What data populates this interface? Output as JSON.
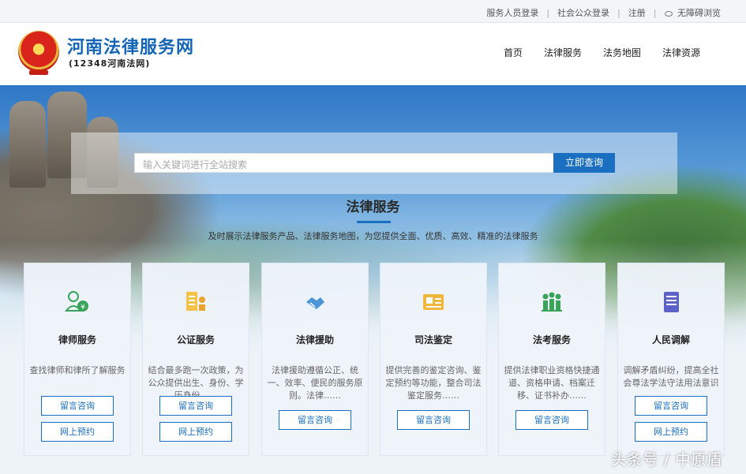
{
  "topbar": {
    "links": [
      "服务人员登录",
      "社会公众登录",
      "注册"
    ],
    "accessibility_label": "无障碍浏览"
  },
  "header": {
    "title": "河南法律服务网",
    "subtitle": "(12348河南法网)",
    "nav": [
      "首页",
      "法律服务",
      "法务地图",
      "法律资源"
    ]
  },
  "search": {
    "placeholder": "输入关键词进行全站搜索",
    "button": "立即查询"
  },
  "section": {
    "title": "法律服务",
    "description": "及时展示法律服务产品、法律服务地图，为您提供全面、优质、高效、精准的法律服务"
  },
  "cards": [
    {
      "name": "律师服务",
      "icon": "lawyer-icon",
      "desc": "查找律师和律所了解服务",
      "buttons": [
        "留言咨询",
        "网上预约"
      ]
    },
    {
      "name": "公证服务",
      "icon": "notary-icon",
      "desc": "结合最多跑一次政策，为公众提供出生、身份、学历身份……",
      "buttons": [
        "留言咨询",
        "网上预约"
      ]
    },
    {
      "name": "法律援助",
      "icon": "handshake-icon",
      "desc": "法律援助遵循公正、统一、效率、便民的服务原则。法律……",
      "buttons": [
        "留言咨询"
      ]
    },
    {
      "name": "司法鉴定",
      "icon": "appraisal-icon",
      "desc": "提供完善的鉴定咨询、鉴定预约等功能，整合司法鉴定服务……",
      "buttons": [
        "留言咨询"
      ]
    },
    {
      "name": "法考服务",
      "icon": "exam-icon",
      "desc": "提供法律职业资格快捷通道、资格申请、档案迁移、证书补办……",
      "buttons": [
        "留言咨询"
      ]
    },
    {
      "name": "人民调解",
      "icon": "mediation-book-icon",
      "desc": "调解矛盾纠纷，提高全社会尊法学法守法用法意识",
      "buttons": [
        "留言咨询",
        "网上预约"
      ]
    }
  ],
  "watermark": "头条号 / 中原盾",
  "colors": {
    "brand_blue": "#1a6fc0",
    "title_blue": "#1565b7",
    "emblem_red": "#d8241b"
  }
}
